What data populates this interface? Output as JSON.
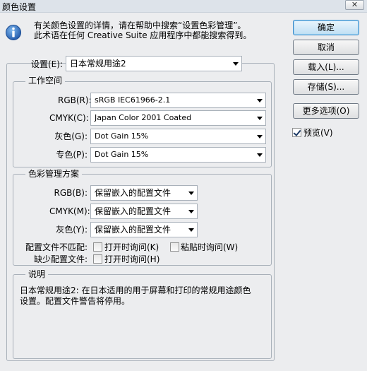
{
  "window": {
    "title": "颜色设置",
    "close_glyph": "✕"
  },
  "info": {
    "line1": "有关颜色设置的详情，请在帮助中搜索“设置色彩管理”。",
    "line2": "此术语在任何 Creative Suite 应用程序中都能搜索得到。"
  },
  "settings": {
    "label": "设置(E):",
    "value": "日本常规用途2"
  },
  "working_spaces": {
    "title": "工作空间",
    "rgb_label": "RGB(R):",
    "rgb_value": "sRGB IEC61966-2.1",
    "cmyk_label": "CMYK(C):",
    "cmyk_value": "Japan Color 2001 Coated",
    "gray_label": "灰色(G):",
    "gray_value": "Dot Gain 15%",
    "spot_label": "专色(P):",
    "spot_value": "Dot Gain 15%"
  },
  "color_management": {
    "title": "色彩管理方案",
    "rgb_label": "RGB(B):",
    "rgb_value": "保留嵌入的配置文件",
    "cmyk_label": "CMYK(M):",
    "cmyk_value": "保留嵌入的配置文件",
    "gray_label": "灰色(Y):",
    "gray_value": "保留嵌入的配置文件",
    "mismatch_label": "配置文件不匹配:",
    "mismatch_open_label": "打开时询问(K)",
    "mismatch_open_checked": false,
    "mismatch_paste_label": "粘贴时询问(W)",
    "mismatch_paste_checked": false,
    "missing_label": "缺少配置文件:",
    "missing_open_label": "打开时询问(H)",
    "missing_open_checked": false
  },
  "description": {
    "title": "说明",
    "line1": "日本常规用途2: 在日本适用的用于屏幕和打印的常规用途颜色",
    "line2": "设置。配置文件警告将停用。"
  },
  "buttons": {
    "ok": "确定",
    "cancel": "取消",
    "load": "载入(L)...",
    "save": "存储(S)...",
    "more_options": "更多选项(O)"
  },
  "preview": {
    "label": "预览(V)",
    "checked": true
  },
  "colors": {
    "accent": "#3a88c8",
    "background": "#ecedef",
    "info_icon": "#2a64b8"
  }
}
